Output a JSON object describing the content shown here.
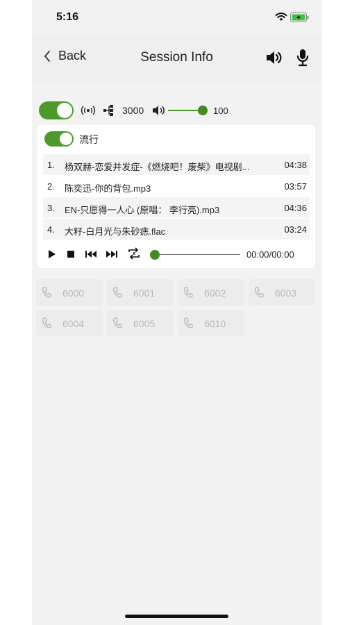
{
  "status_bar": {
    "time": "5:16"
  },
  "nav": {
    "back_label": "Back",
    "title": "Session Info"
  },
  "controls": {
    "broadcast_toggle_on": true,
    "port_value": "3000",
    "volume_value": "100",
    "volume_level": 1.0
  },
  "playlist_card": {
    "group_toggle_on": true,
    "group_label": "流行",
    "tracks": [
      {
        "num": "1.",
        "title": "杨双赫-恋爱并发症-《燃烧吧！废柴》电视剧...",
        "duration": "04:38"
      },
      {
        "num": "2.",
        "title": "陈奕迅-你的背包.mp3",
        "duration": "03:57"
      },
      {
        "num": "3.",
        "title": "EN-只愿得一人心 (原唱： 李行亮).mp3",
        "duration": "04:36"
      },
      {
        "num": "4.",
        "title": "大籽-白月光与朱砂痣.flac",
        "duration": "03:24"
      }
    ],
    "player": {
      "time": "00:00/00:00",
      "progress": 0.0
    }
  },
  "extensions": [
    "6000",
    "6001",
    "6002",
    "6003",
    "6004",
    "6005",
    "6010"
  ],
  "colors": {
    "accent": "#4d9a2a",
    "background": "#f2f2f2",
    "card": "#ffffff",
    "tile": "#ececec",
    "tile_text": "#b8b8b8"
  },
  "icons": [
    "wifi-icon",
    "battery-icon",
    "back-chevron-icon",
    "speaker-icon",
    "microphone-icon",
    "broadcast-icon",
    "network-icon",
    "volume-icon",
    "play-icon",
    "stop-icon",
    "previous-icon",
    "next-icon",
    "repeat-icon",
    "phone-icon"
  ]
}
